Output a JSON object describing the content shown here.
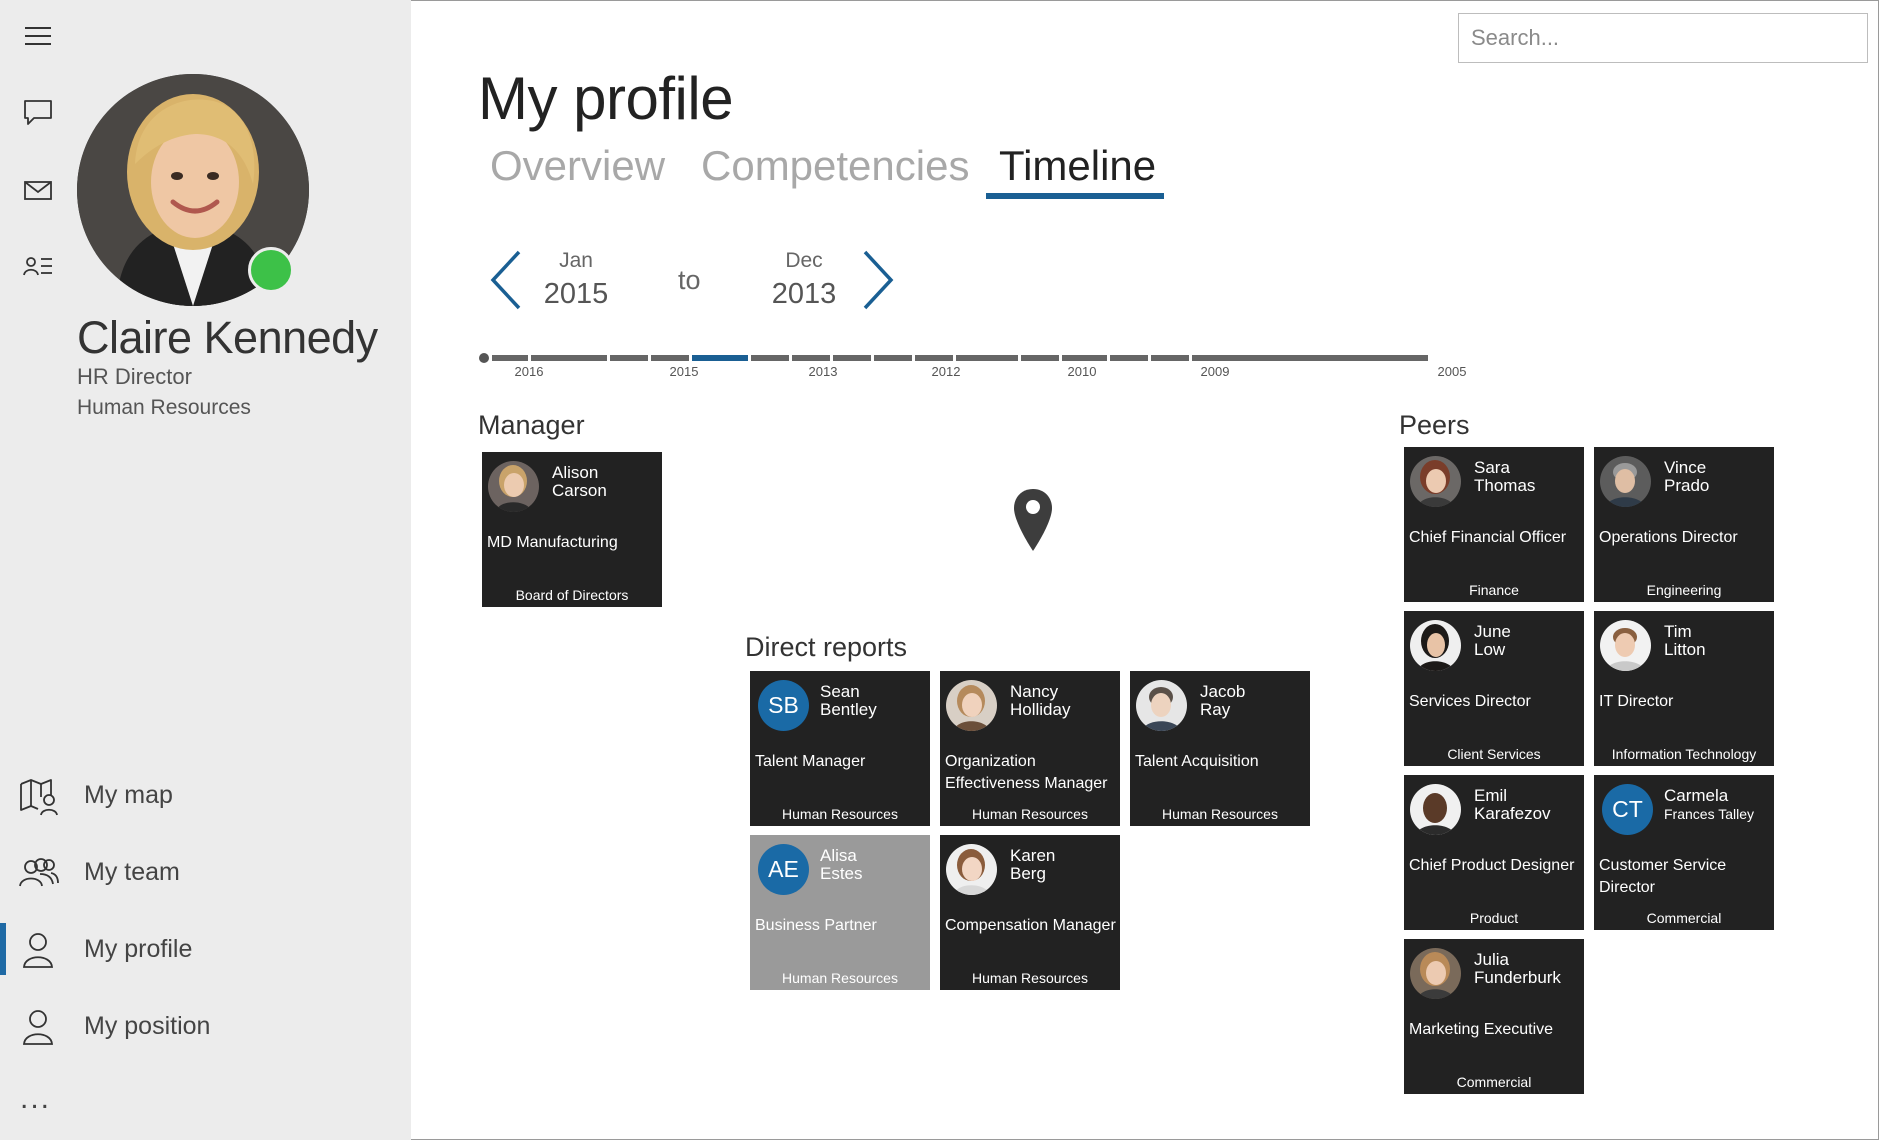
{
  "search": {
    "placeholder": "Search..."
  },
  "profile": {
    "name": "Claire Kennedy",
    "role": "HR Director",
    "department": "Human Resources",
    "presence_color": "#3dc148"
  },
  "nav": {
    "items": [
      {
        "label": "My map",
        "icon": "map-person-icon",
        "active": false
      },
      {
        "label": "My team",
        "icon": "team-icon",
        "active": false
      },
      {
        "label": "My profile",
        "icon": "person-icon",
        "active": true
      },
      {
        "label": "My position",
        "icon": "person-icon",
        "active": false
      }
    ],
    "more": "..."
  },
  "page": {
    "title": "My profile"
  },
  "tabs": [
    {
      "label": "Overview",
      "active": false
    },
    {
      "label": "Competencies",
      "active": false
    },
    {
      "label": "Timeline",
      "active": true
    }
  ],
  "range": {
    "from_month": "Jan",
    "from_year": "2015",
    "to_label": "to",
    "to_month": "Dec",
    "to_year": "2013"
  },
  "timeline": {
    "labels": [
      "2016",
      "2015",
      "2013",
      "2012",
      "2010",
      "2009",
      "2005"
    ],
    "accent": "#1a5f93"
  },
  "sections": {
    "manager": "Manager",
    "direct_reports": "Direct reports",
    "peers": "Peers"
  },
  "manager": {
    "first": "Alison",
    "last": "Carson",
    "title": "MD Manufacturing",
    "dept": "Board of Directors"
  },
  "direct_reports": [
    {
      "first": "Sean",
      "last": "Bentley",
      "initials": "SB",
      "title": "Talent Manager",
      "dept": "Human Resources"
    },
    {
      "first": "Nancy",
      "last": "Holliday",
      "title": "Organization Effectiveness Manager",
      "dept": "Human Resources"
    },
    {
      "first": "Jacob",
      "last": "Ray",
      "title": "Talent Acquisition",
      "dept": "Human Resources"
    },
    {
      "first": "Alisa",
      "last": "Estes",
      "initials": "AE",
      "title": "Business Partner",
      "dept": "Human Resources"
    },
    {
      "first": "Karen",
      "last": "Berg",
      "title": "Compensation Manager",
      "dept": "Human Resources"
    }
  ],
  "peers": [
    {
      "first": "Sara",
      "last": "Thomas",
      "title": "Chief Financial Officer",
      "dept": "Finance"
    },
    {
      "first": "Vince",
      "last": "Prado",
      "title": "Operations Director",
      "dept": "Engineering"
    },
    {
      "first": "June",
      "last": "Low",
      "title": "Services Director",
      "dept": "Client Services"
    },
    {
      "first": "Tim",
      "last": "Litton",
      "title": "IT Director",
      "dept": "Information Technology"
    },
    {
      "first": "Emil",
      "last": "Karafezov",
      "title": "Chief Product Designer",
      "dept": "Product"
    },
    {
      "first": "Carmela",
      "last": "Frances Talley",
      "initials": "CT",
      "title": "Customer Service Director",
      "dept": "Commercial"
    },
    {
      "first": "Julia",
      "last": "Funderburk",
      "title": "Marketing Executive",
      "dept": "Commercial"
    }
  ]
}
